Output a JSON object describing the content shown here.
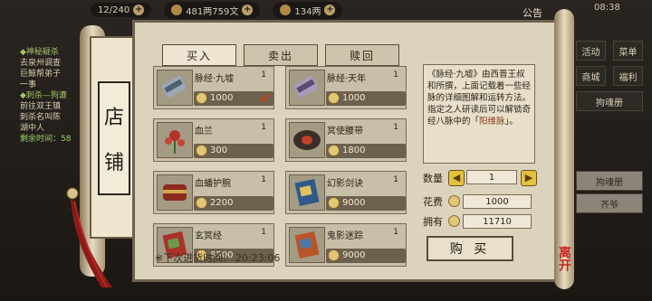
{
  "hud": {
    "stamina": "12/240",
    "money": "481两759文",
    "resource": "134两",
    "notice": "公告",
    "clock": "08:38"
  },
  "quest": {
    "title1": "神秘疑杀",
    "lines1": [
      "去泉州调查",
      "巨鲸帮弟子",
      "一事"
    ],
    "title2": "刺杀—狗漉",
    "lines2": [
      "前往双王镇",
      "刺杀名叫陈",
      "湖中人",
      "剩余时间：58"
    ]
  },
  "sidemenu": [
    "活动",
    "菜单",
    "商城",
    "福利",
    "拘魂册",
    "拘魂册",
    "齐爷"
  ],
  "shop": {
    "title_top": "店",
    "title_bottom": "铺",
    "tabs": [
      "买入",
      "卖出",
      "赎回"
    ],
    "items": [
      {
        "name": "脉经·九墟",
        "qty": "1",
        "price": "1000",
        "icon": "scroll-icon",
        "selected": true
      },
      {
        "name": "脉经·天年",
        "qty": "1",
        "price": "1000",
        "icon": "scroll-icon",
        "selected": false
      },
      {
        "name": "血兰",
        "qty": "1",
        "price": "300",
        "icon": "flower-icon",
        "selected": false
      },
      {
        "name": "冥使腰带",
        "qty": "1",
        "price": "1800",
        "icon": "belt-icon",
        "selected": false
      },
      {
        "name": "血蟠护腕",
        "qty": "1",
        "price": "2200",
        "icon": "bracer-icon",
        "selected": false
      },
      {
        "name": "幻影剑诀",
        "qty": "1",
        "price": "9000",
        "icon": "book-icon",
        "selected": false
      },
      {
        "name": "玄冥经",
        "qty": "1",
        "price": "8500",
        "icon": "book-icon",
        "selected": false
      },
      {
        "name": "鬼影迷踪",
        "qty": "1",
        "price": "9000",
        "icon": "book-icon",
        "selected": false
      }
    ],
    "restock_label": "※下次进货时间:",
    "restock_time": "20:23:06"
  },
  "detail": {
    "desc_prefix": "《脉经·九墟》由西晋王叔和所撰，上面记载着一些经脉的详细图解和运转方法。",
    "desc_mid": "指定之人研读后可以解锁奇经八脉中的「",
    "desc_highlight": "阳维脉",
    "desc_suffix": "」。",
    "qty_label": "数量",
    "qty_value": "1",
    "cost_label": "花费",
    "cost_value": "1000",
    "own_label": "拥有",
    "own_value": "11710",
    "buy_label": "购 买"
  },
  "leave": "离开"
}
